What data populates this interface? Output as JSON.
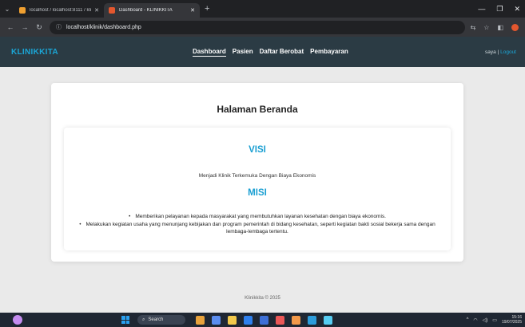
{
  "browser": {
    "tabs": [
      {
        "label": "localhost / localhost:8111 / klin",
        "active": false
      },
      {
        "label": "Dashboard - KLINIKKITA",
        "active": true
      }
    ],
    "url": "localhost/klinik/dashboard.php"
  },
  "navbar": {
    "brand": "KLINIKKITA",
    "menu": [
      "Dashboard",
      "Pasien",
      "Daftar Berobat",
      "Pembayaran"
    ],
    "active_menu": "Dashboard",
    "user": "saya",
    "separator": "|",
    "logout": "Logout"
  },
  "main": {
    "title": "Halaman Beranda",
    "visi_heading": "VISI",
    "visi_text": "Menjadi Klinik Terkemuka Dengan Biaya Ekonomis",
    "misi_heading": "MISI",
    "misi_items": [
      "Memberikan pelayanan kepada masyarakat yang membutuhkan layanan kesehatan dengan biaya ekonomis.",
      "Melakukan kegiatan usaha yang menunjang kebijakan dan program pemerintah di bidang kesehatan, seperti kegiatan bakti sosial bekerja sama dengan lembaga-lembaga tertentu."
    ]
  },
  "footer": "Klinikkita © 2025",
  "taskbar": {
    "search_label": "Search",
    "time": "15:16",
    "date": "19/07/2025"
  },
  "colors": {
    "accent": "#1ba6d6",
    "navbar_bg": "#2b3b44",
    "page_bg": "#eaeaea"
  }
}
